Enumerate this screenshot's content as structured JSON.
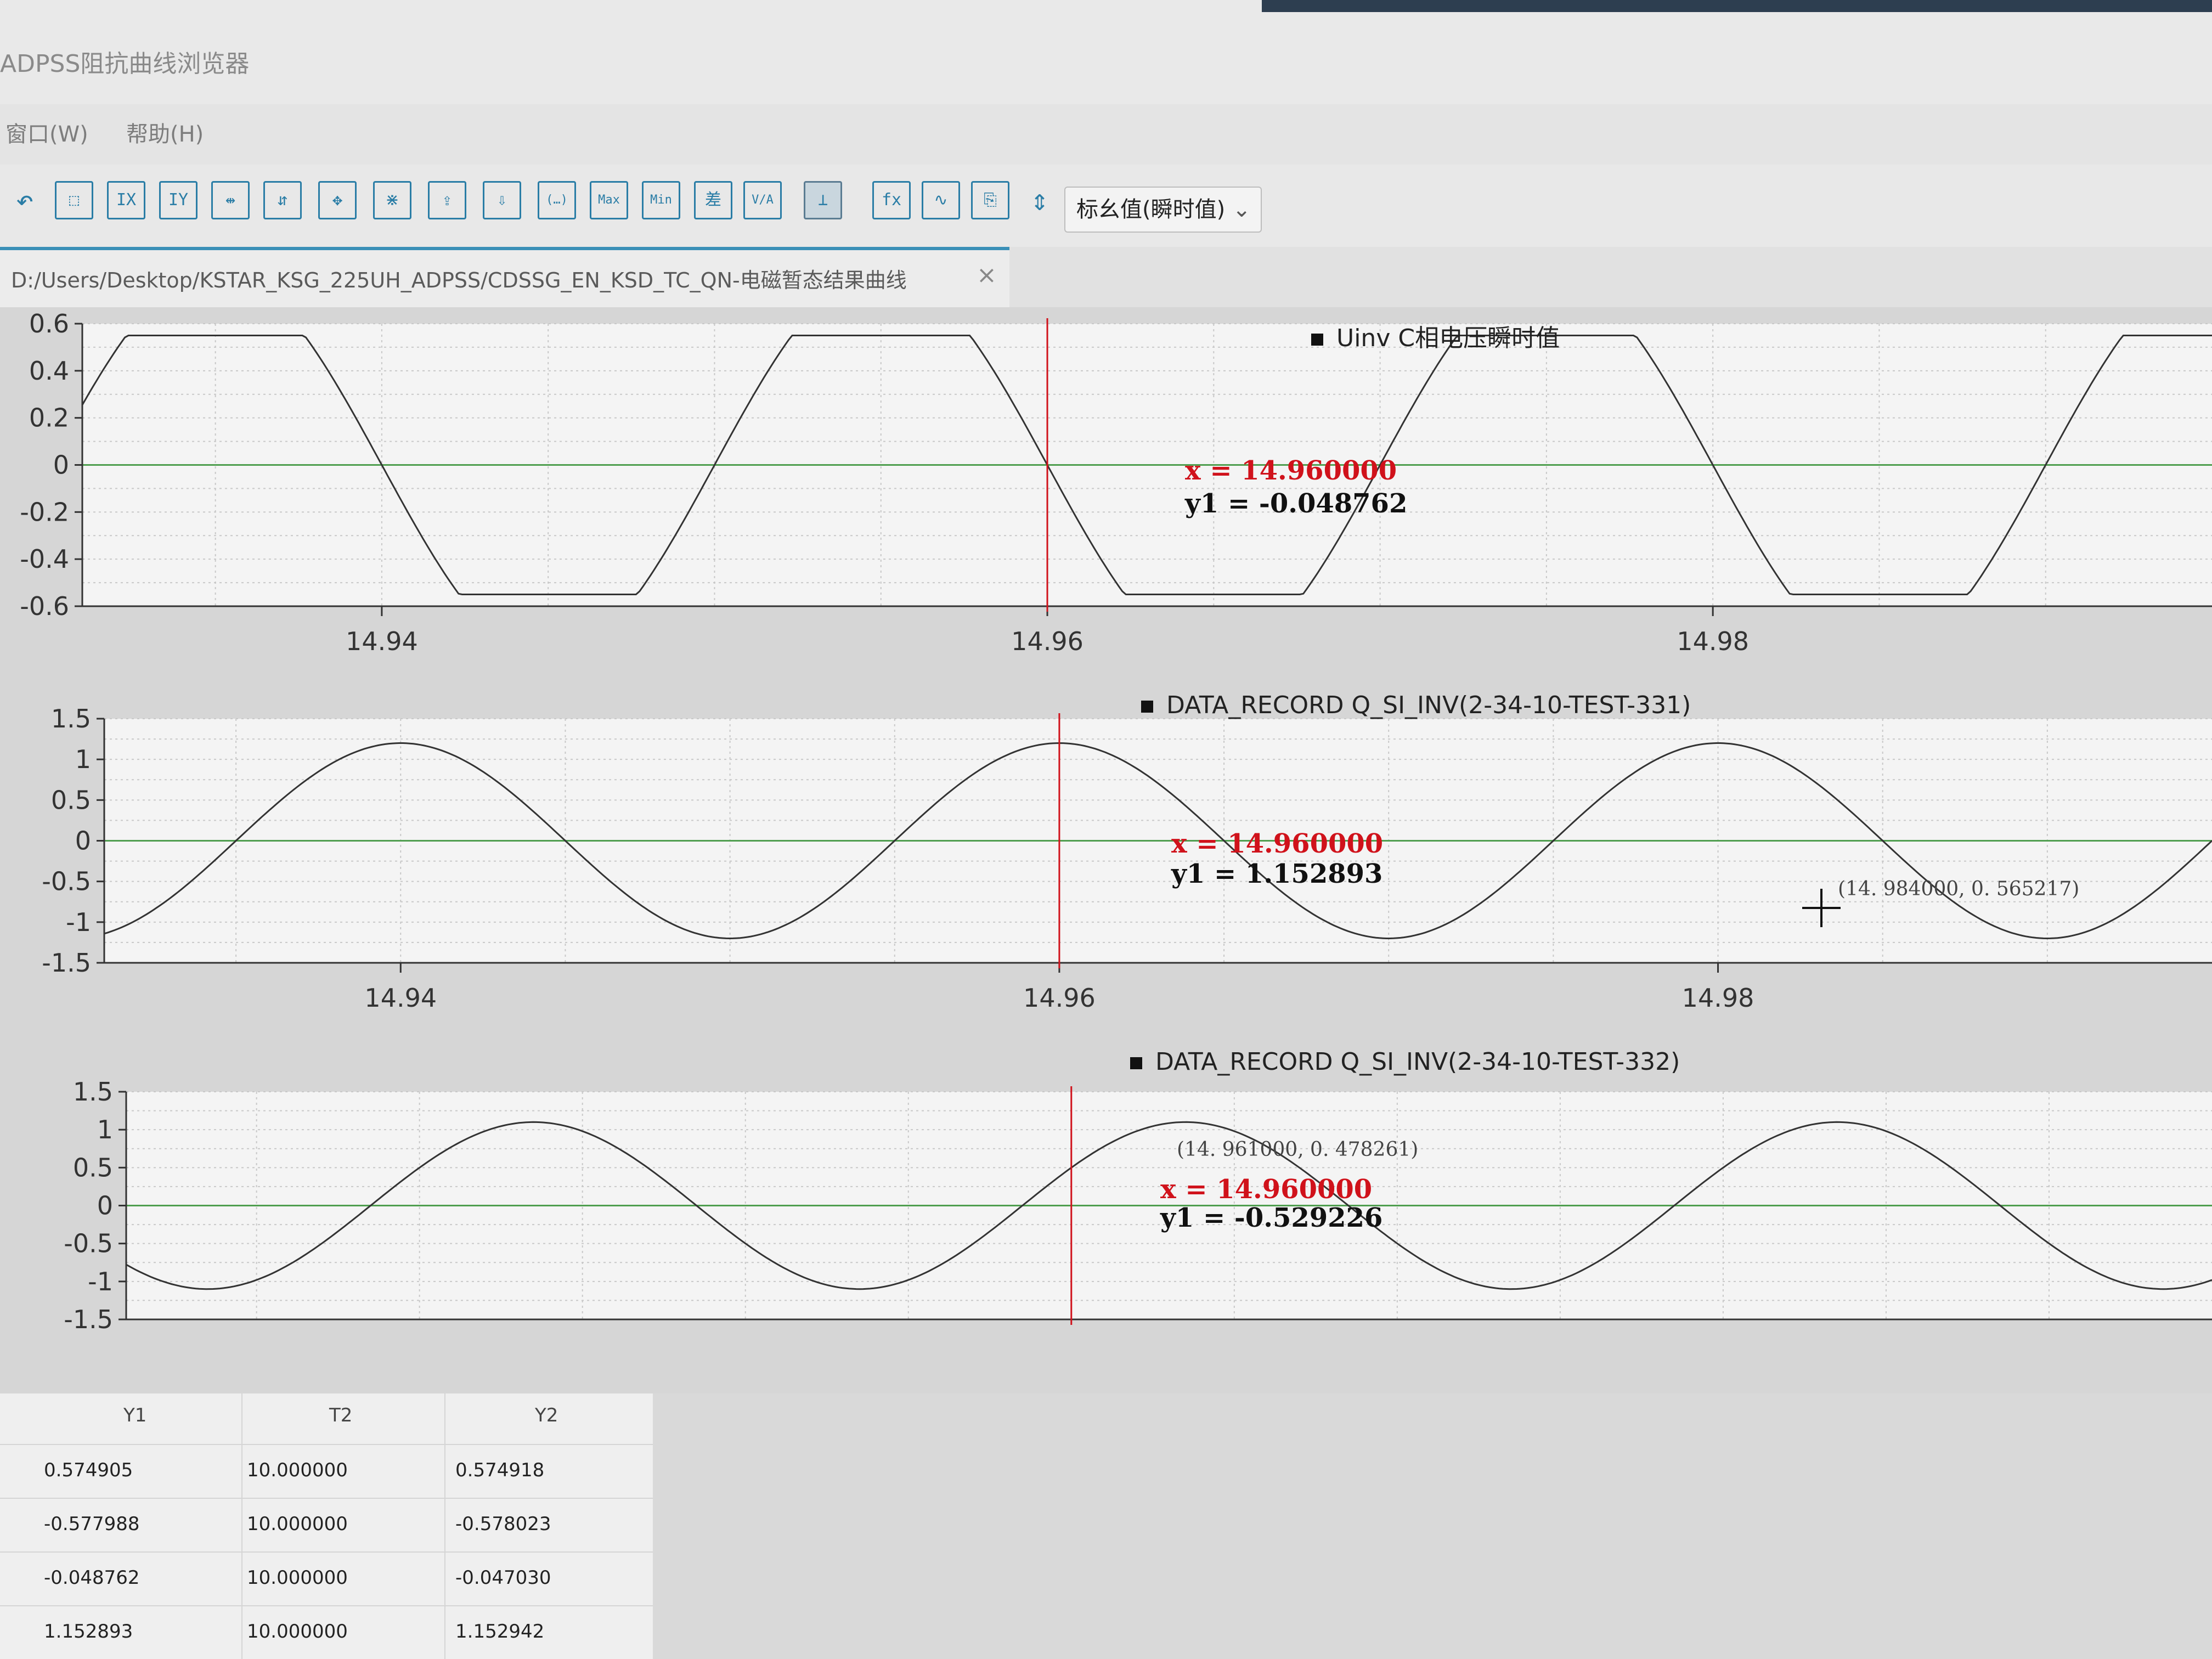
{
  "window": {
    "title": "ADPSS阻抗曲线浏览器"
  },
  "menu": {
    "items": [
      "窗口(W)",
      "帮助(H)"
    ]
  },
  "toolbar": {
    "buttons": [
      {
        "name": "undo-icon",
        "glyph": "↶"
      },
      {
        "name": "zoom-box-icon",
        "glyph": "⬚"
      },
      {
        "name": "zoom-x-icon",
        "glyph": "IX"
      },
      {
        "name": "zoom-y-icon",
        "glyph": "IY"
      },
      {
        "name": "fit-x-icon",
        "glyph": "⇹"
      },
      {
        "name": "fit-y-icon",
        "glyph": "⇵"
      },
      {
        "name": "fit-all-icon",
        "glyph": "✥"
      },
      {
        "name": "split-icon",
        "glyph": "⋇"
      },
      {
        "name": "export-icon",
        "glyph": "⇪"
      },
      {
        "name": "import-icon",
        "glyph": "⇩"
      },
      {
        "name": "bracket-icon",
        "glyph": "(…)"
      },
      {
        "name": "max-icon",
        "glyph": "Max"
      },
      {
        "name": "min-icon",
        "glyph": "Min"
      },
      {
        "name": "diff-icon",
        "glyph": "差"
      },
      {
        "name": "va-icon",
        "glyph": "V/A"
      },
      {
        "name": "marker-icon",
        "glyph": "⊥"
      },
      {
        "name": "fx-icon",
        "glyph": "fx"
      },
      {
        "name": "wave-icon",
        "glyph": "∿"
      },
      {
        "name": "copy-icon",
        "glyph": "⎘"
      },
      {
        "name": "sort-icon",
        "glyph": "⇕"
      }
    ],
    "mode_select": "标幺值(瞬时值)"
  },
  "file_tab": {
    "path": "D:/Users/Desktop/KSTAR_KSG_225UH_ADPSS/CDSSG_EN_KSD_TC_QN-电磁暂态结果曲线",
    "close": "×"
  },
  "plots": [
    {
      "title": "Uinv C相电压瞬时值",
      "cursor_x_label": "x = 14.960000",
      "cursor_y_label": "y1 = -0.048762",
      "y_ticks": [
        "0.6",
        "0.4",
        "0.2",
        "0",
        "-0.2",
        "-0.4",
        "-0.6"
      ],
      "x_ticks": [
        "14.94",
        "14.96",
        "14.98"
      ]
    },
    {
      "title": "DATA_RECORD Q_SI_INV(2-34-10-TEST-331)",
      "cursor_x_label": "x = 14.960000",
      "cursor_y_label": "y1 = 1.152893",
      "coord_label": "(14. 984000, 0. 565217)",
      "y_ticks": [
        "1.5",
        "1",
        "0.5",
        "0",
        "-0.5",
        "-1",
        "-1.5"
      ],
      "x_ticks": [
        "14.94",
        "14.96",
        "14.98"
      ]
    },
    {
      "title": "DATA_RECORD Q_SI_INV(2-34-10-TEST-332)",
      "cursor_x_label": "x = 14.960000",
      "cursor_y_label": "y1 = -0.529226",
      "coord_label": "(14. 961000, 0. 478261)",
      "y_ticks": [
        "1.5",
        "1",
        "0.5",
        "0",
        "-0.5",
        "-1",
        "-1.5"
      ],
      "x_ticks": []
    }
  ],
  "chart_data": [
    {
      "type": "line",
      "title": "Uinv C相电压瞬时值",
      "x_range": [
        14.931,
        14.995
      ],
      "ylim": [
        -0.6,
        0.6
      ],
      "cursor_x": 14.96,
      "series": [
        {
          "shape": "clipped-sine",
          "period": 0.02,
          "peak": 0.55,
          "zero_cross_down": 14.96
        }
      ]
    },
    {
      "type": "line",
      "title": "DATA_RECORD Q_SI_INV(2-34-10-TEST-331)",
      "x_range": [
        14.931,
        14.995
      ],
      "ylim": [
        -1.5,
        1.5
      ],
      "cursor_x": 14.96,
      "series": [
        {
          "shape": "sine",
          "period": 0.02,
          "amplitude": 1.2,
          "peak_at": 14.96
        }
      ]
    },
    {
      "type": "line",
      "title": "DATA_RECORD Q_SI_INV(2-34-10-TEST-332)",
      "x_range": [
        14.931,
        14.995
      ],
      "ylim": [
        -1.5,
        1.5
      ],
      "cursor_x": 14.96,
      "series": [
        {
          "shape": "sine",
          "period": 0.02,
          "amplitude": 1.1,
          "peak_at": 14.9635
        }
      ]
    }
  ],
  "table": {
    "headers": [
      "Y1",
      "T2",
      "Y2"
    ],
    "rows": [
      [
        "0.574905",
        "10.000000",
        "0.574918"
      ],
      [
        "-0.577988",
        "10.000000",
        "-0.578023"
      ],
      [
        "-0.048762",
        "10.000000",
        "-0.047030"
      ],
      [
        "1.152893",
        "10.000000",
        "1.152942"
      ]
    ]
  }
}
